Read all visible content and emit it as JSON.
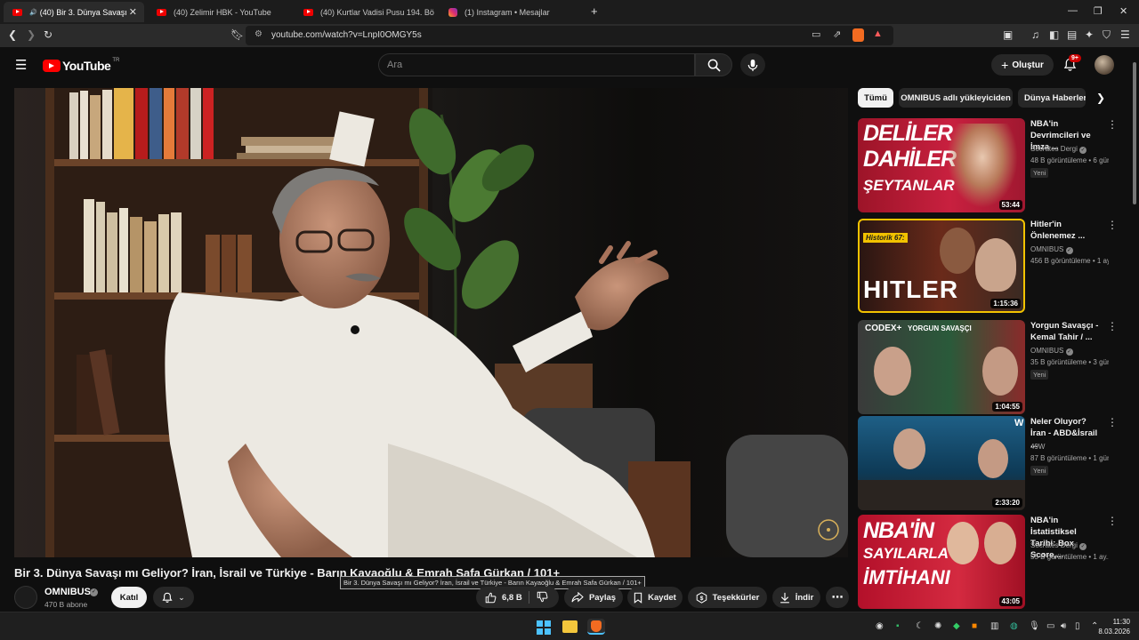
{
  "browser": {
    "tabs": [
      {
        "label": "(40) Bir 3. Dünya Savaşı mı Ge",
        "active": true
      },
      {
        "label": "(40) Zelimir HBK - YouTube",
        "active": false
      },
      {
        "label": "(40) Kurtlar Vadisi Pusu 194. Bölüm",
        "active": false
      },
      {
        "label": "(1) Instagram • Mesajlar",
        "active": false
      }
    ],
    "new_tab": "+",
    "url": "youtube.com/watch?v=LnpI0OMGY5s"
  },
  "youtube": {
    "logo_text": "YouTube",
    "logo_region": "TR",
    "search_placeholder": "Ara",
    "create_label": "Oluştur",
    "notif_count": "9+"
  },
  "video": {
    "title": "Bir 3. Dünya Savaşı mı Geliyor? İran, İsrail ve Türkiye - Barın Kayaoğlu & Emrah Safa Gürkan / 101+",
    "tooltip": "Bir 3. Dünya Savaşı mı Geliyor? İran, İsrail ve Türkiye - Barın Kayaoğlu & Emrah Safa Gürkan / 101+",
    "channel": "OMNIBUS",
    "subscribers": "470 B abone",
    "join_label": "Katıl",
    "likes": "6,8 B",
    "share_label": "Paylaş",
    "save_label": "Kaydet",
    "thanks_label": "Teşekkürler",
    "download_label": "İndir"
  },
  "chips": [
    "Tümü",
    "OMNIBUS adlı yükleyiciden",
    "Dünya Haberleri"
  ],
  "recommendations": [
    {
      "title": "NBA'in Devrimcileri ve İmza ...",
      "channel": "Socrates Dergi",
      "meta": "48 B görüntüleme • 6 gün...",
      "badge": "Yeni",
      "duration": "53:44",
      "thumb_text": [
        "DELİLER",
        "DAHİLER",
        "ŞEYTANLAR"
      ]
    },
    {
      "title": "Hitler'in Önlenemez ...",
      "channel": "OMNIBUS",
      "meta": "456 B görüntüleme • 1 ay...",
      "badge": "",
      "duration": "1:15:36",
      "thumb_text": [
        "Historik 67:",
        "HITLER"
      ]
    },
    {
      "title": "Yorgun Savaşçı - Kemal Tahir / ...",
      "channel": "OMNIBUS",
      "meta": "35 B görüntüleme • 3 gün...",
      "badge": "Yeni",
      "duration": "1:04:55",
      "thumb_text": [
        "CODEX+",
        "YORGUN SAVAŞÇI"
      ]
    },
    {
      "title": "Neler Oluyor? İran - ABD&İsrail ...",
      "channel": "49W",
      "meta": "87 B görüntüleme • 1 gün...",
      "badge": "Yeni",
      "duration": "2:33:20",
      "thumb_text": []
    },
    {
      "title": "NBA'in İstatistiksel Tarihi: Box Score,...",
      "channel": "Socrates Dergi",
      "meta": "55 B görüntüleme • 1 ay...",
      "badge": "",
      "duration": "43:05",
      "thumb_text": [
        "NBA'İN",
        "SAYILARLA",
        "İMTİHANI"
      ]
    }
  ],
  "taskbar": {
    "time": "11:30",
    "date": "8.03.2026"
  },
  "colors": {
    "yt_red": "#ff0000",
    "bg": "#0f0f0f",
    "chip_bg": "#272727"
  }
}
